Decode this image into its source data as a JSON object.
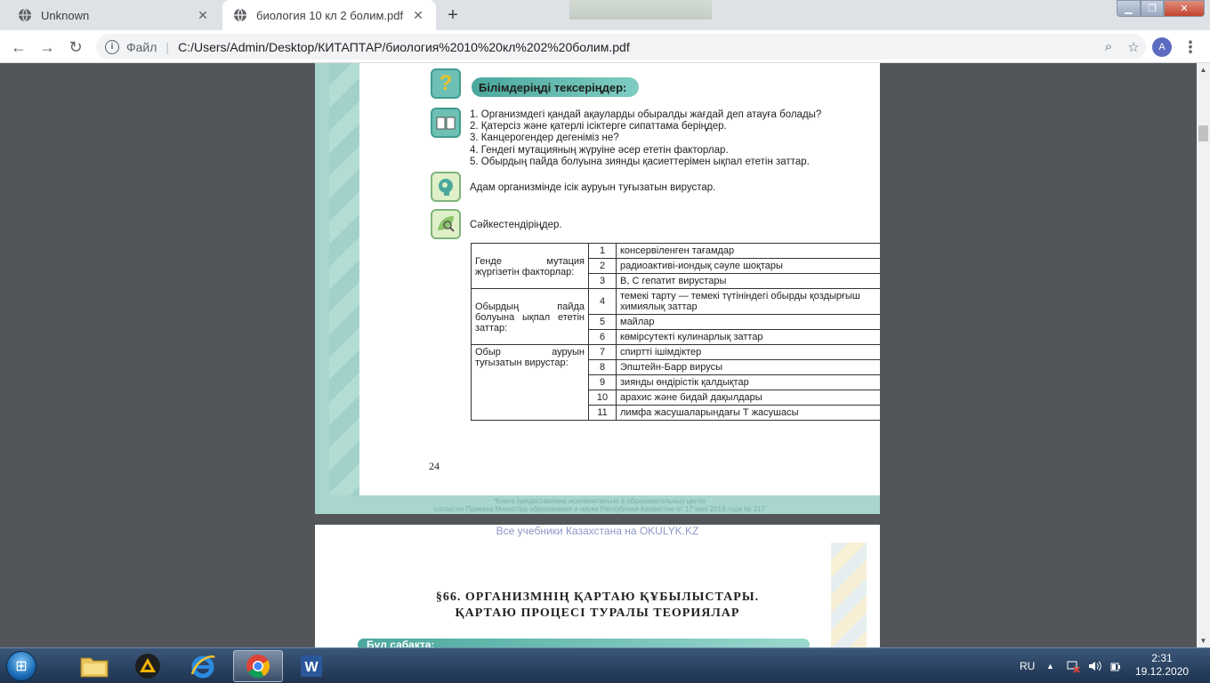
{
  "browser": {
    "tabs": [
      {
        "title": "Unknown",
        "active": false
      },
      {
        "title": "биология 10 кл 2 болим.pdf",
        "active": true
      }
    ],
    "new_tab_icon": "plus-icon",
    "address": {
      "scheme_label": "Файл",
      "url": "C:/Users/Admin/Desktop/КИТАПТАР/биология%2010%20кл%202%20болим.pdf"
    },
    "profile_initial": "A"
  },
  "pdf": {
    "page1": {
      "heading": "Білімдеріңді тексеріңдер:",
      "questions": [
        "1. Организмдегі қандай ақауларды обыралды жағдай деп атауға болады?",
        "2. Қатерсіз және қатерлі ісіктерге сипаттама беріңдер.",
        "3. Канцерогендер дегеніміз не?",
        "4. Гендегі мутацияның жүруіне әсер ететін факторлар.",
        "5. Обырдың пайда болуына зиянды қасиеттерімен ықпал ететін заттар."
      ],
      "task_viruses": "Адам организмінде ісік ауруын туғызатын вирустар.",
      "task_match": "Сәйкестендіріңдер.",
      "groups": [
        "Генде мутация жүргізетін факторлар:",
        "Обырдың пайда болуына ықпал ететін заттар:",
        "Обыр ауруын туғызатын вирустар:"
      ],
      "items": [
        {
          "num": "1",
          "text": "консервіленген тағамдар"
        },
        {
          "num": "2",
          "text": "радиоактиві-иондық сәуле шоқтары"
        },
        {
          "num": "3",
          "text": "В, С гепатит вирустары"
        },
        {
          "num": "4",
          "text": "темекі тарту — темекі түтініндегі обырды қоздырғыш химиялық заттар"
        },
        {
          "num": "5",
          "text": "майлар"
        },
        {
          "num": "6",
          "text": "көмірсутекті кулинарлық заттар"
        },
        {
          "num": "7",
          "text": "спиртті ішімдіктер"
        },
        {
          "num": "8",
          "text": "Эпштейн-Барр вирусы"
        },
        {
          "num": "9",
          "text": "зиянды өндірістік қалдықтар"
        },
        {
          "num": "10",
          "text": "арахис және бидай дақылдары"
        },
        {
          "num": "11",
          "text": "лимфа жасушаларындағы Т жасушасы"
        }
      ],
      "page_number": "24",
      "footer_line1": "*Книга предоставлена исключительно в образовательных целях",
      "footer_line2": "согласно Приказа Министра образования и науки Республики Казахстан от 17 мая 2019 года № 217"
    },
    "page2": {
      "watermark": "Все учебники Казахстана на OKULYK.KZ",
      "title_line1": "§66. ОРГАНИЗМНІҢ ҚАРТАЮ ҚҰБЫЛЫСТАРЫ.",
      "title_line2": "ҚАРТАЮ ПРОЦЕСІ ТУРАЛЫ ТЕОРИЯЛАР",
      "pill": "Бүл сабақта:"
    }
  },
  "taskbar": {
    "language": "RU",
    "time": "2:31",
    "date": "19.12.2020"
  }
}
